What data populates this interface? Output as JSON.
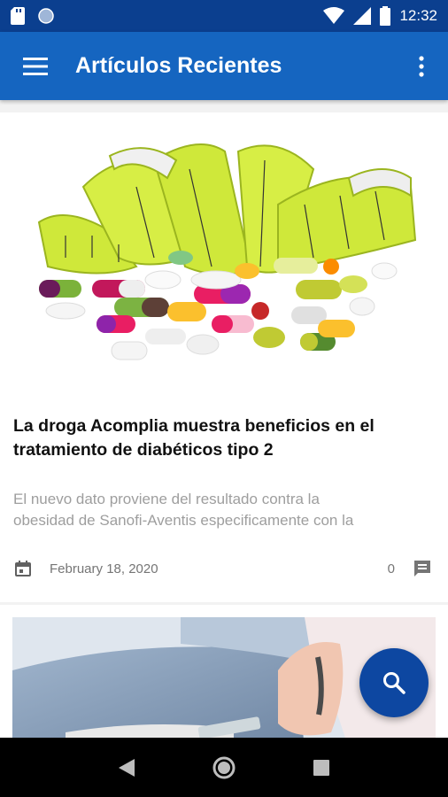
{
  "status_bar": {
    "time": "12:32",
    "icons": [
      "sd-card-icon",
      "circle-notification-icon",
      "wifi-icon",
      "signal-icon",
      "battery-icon"
    ]
  },
  "app_bar": {
    "title": "Artículos Recientes",
    "icons": [
      "menu-icon",
      "more-vert-icon"
    ]
  },
  "articles": [
    {
      "title": "La droga Acomplia muestra beneficios en el tratamiento de diabéticos tipo 2",
      "excerpt_line1": "El nuevo dato proviene del resultado contra la",
      "excerpt_line2": "obesidad de Sanofi-Aventis especificamente con la",
      "date": "February 18, 2020",
      "comments": "0"
    }
  ],
  "fab": {
    "icon": "search-icon"
  },
  "nav_bar": {
    "icons": [
      "back-icon",
      "home-icon",
      "recents-icon"
    ]
  },
  "colors": {
    "status_bar": "#0b3f8f",
    "app_bar": "#1565c0",
    "fab": "#0d47a1",
    "excerpt_text": "#9e9e9e",
    "background": "#f2f2f2"
  }
}
